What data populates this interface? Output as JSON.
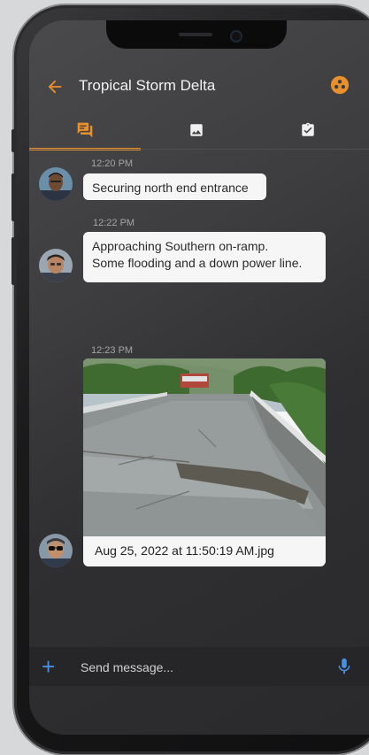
{
  "header": {
    "title": "Tropical Storm Delta"
  },
  "tabs": [
    {
      "name": "chat",
      "icon": "chat-bubbles-icon",
      "selected": true
    },
    {
      "name": "gallery",
      "icon": "image-icon",
      "selected": false
    },
    {
      "name": "tasks",
      "icon": "clipboard-check-icon",
      "selected": false
    }
  ],
  "messages": [
    {
      "time": "12:20 PM",
      "text": "Securing north end entrance",
      "avatar": "avatar-1"
    },
    {
      "time": "12:22 PM",
      "line1": "Approaching Southern on-ramp.",
      "line2": "Some flooding and a down power line.",
      "avatar": "avatar-2"
    },
    {
      "time": "12:23 PM",
      "attachment_caption": "Aug 25, 2022 at 11:50:19 AM.jpg",
      "avatar": "avatar-3"
    }
  ],
  "composer": {
    "placeholder": "Send message..."
  },
  "colors": {
    "accent": "#e9902d",
    "composer_icons": "#4a8fe0",
    "bubble": "#f6f6f6",
    "background": "#3d3d3f"
  }
}
